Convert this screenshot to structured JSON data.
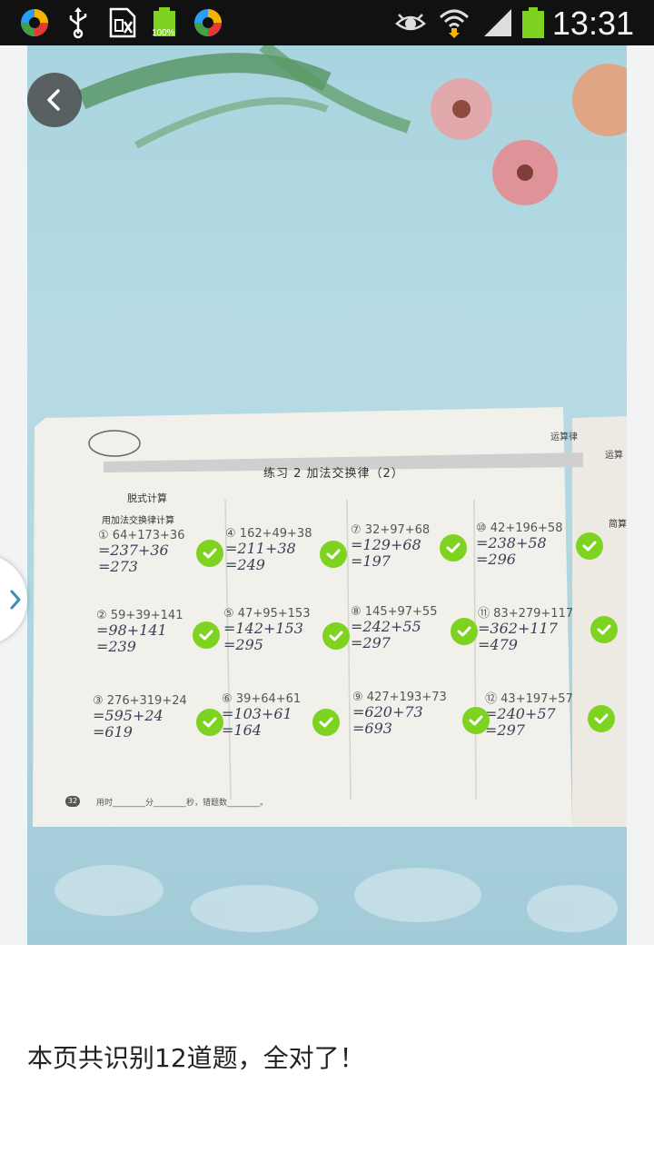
{
  "status_bar": {
    "time": "13:31",
    "battery_small_label": "100%",
    "icons": [
      "colorful-app-icon",
      "usb-icon",
      "sim-icon",
      "battery-full-icon",
      "colorful-app-icon",
      "eye-icon",
      "wifi-icon",
      "signal-icon",
      "battery-icon"
    ],
    "battery_color": "#7ed321"
  },
  "navigation": {
    "back_icon": "chevron-left-icon",
    "side_tab_icon": "chevron-right-icon"
  },
  "worksheet": {
    "header_right": "运算律",
    "header_right2": "运算",
    "title": "练习 2   加法交换律（2）",
    "section": "脱式计算",
    "instruction": "用加法交换律计算",
    "right_small": "简算",
    "footer": "用时________分________秒，错题数________。",
    "page_number": "32",
    "problems": [
      {
        "num": "①",
        "expr": "64+173+36",
        "line1": "=237+36",
        "line2": "=273"
      },
      {
        "num": "④",
        "expr": "162+49+38",
        "line1": "=211+38",
        "line2": "=249"
      },
      {
        "num": "⑦",
        "expr": "32+97+68",
        "line1": "=129+68",
        "line2": "=197"
      },
      {
        "num": "⑩",
        "expr": "42+196+58",
        "line1": "=238+58",
        "line2": "=296"
      },
      {
        "num": "②",
        "expr": "59+39+141",
        "line1": "=98+141",
        "line2": "=239"
      },
      {
        "num": "⑤",
        "expr": "47+95+153",
        "line1": "=142+153",
        "line2": "=295"
      },
      {
        "num": "⑧",
        "expr": "145+97+55",
        "line1": "=242+55",
        "line2": "=297"
      },
      {
        "num": "⑪",
        "expr": "83+279+117",
        "line1": "=362+117",
        "line2": "=479"
      },
      {
        "num": "③",
        "expr": "276+319+24",
        "line1": "=595+24",
        "line2": "=619"
      },
      {
        "num": "⑥",
        "expr": "39+64+61",
        "line1": "=103+61",
        "line2": "=164"
      },
      {
        "num": "⑨",
        "expr": "427+193+73",
        "line1": "=620+73",
        "line2": "=693"
      },
      {
        "num": "⑫",
        "expr": "43+197+57",
        "line1": "=240+57",
        "line2": "=297"
      }
    ],
    "check_color": "#7ed321"
  },
  "result": {
    "text": "本页共识别12道题，全对了！"
  }
}
